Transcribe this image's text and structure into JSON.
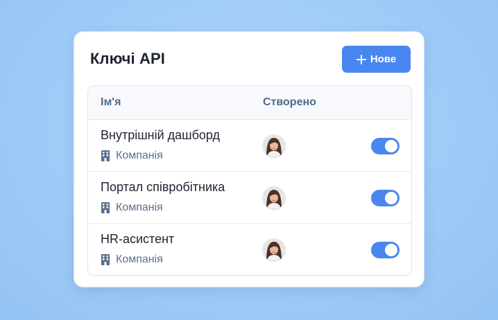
{
  "card": {
    "title": "Ключі API",
    "new_button_label": "Нове"
  },
  "table": {
    "columns": [
      "Ім'я",
      "Створено"
    ],
    "rows": [
      {
        "name": "Внутрішній дашборд",
        "type": "Компанія",
        "enabled": true
      },
      {
        "name": "Портал співробітника",
        "type": "Компанія",
        "enabled": true
      },
      {
        "name": "HR-асистент",
        "type": "Компанія",
        "enabled": true
      }
    ]
  },
  "colors": {
    "accent": "#4a86f0",
    "background": "#a3cef8",
    "text": "#1d2230",
    "muted": "#5a6f8c"
  },
  "icons": [
    "plus-icon",
    "building-icon",
    "avatar"
  ]
}
